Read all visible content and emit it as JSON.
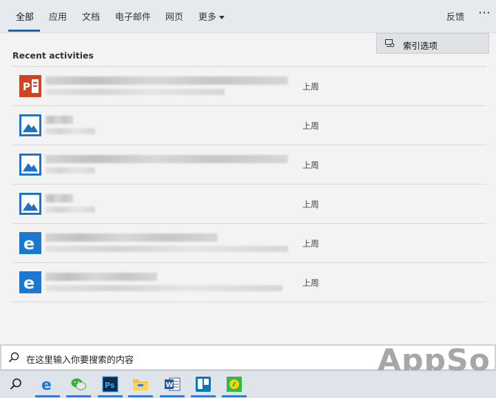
{
  "tabs": [
    {
      "label": "全部"
    },
    {
      "label": "应用"
    },
    {
      "label": "文档"
    },
    {
      "label": "电子邮件"
    },
    {
      "label": "网页"
    },
    {
      "label": "更多"
    }
  ],
  "header": {
    "feedback": "反馈",
    "ellipsis": "⋯"
  },
  "menu": {
    "index_options": "索引选项"
  },
  "recent": {
    "title": "Recent activities",
    "items": [
      {
        "icon": "powerpoint-icon",
        "time": "上周"
      },
      {
        "icon": "photos-icon",
        "time": "上周"
      },
      {
        "icon": "photos-icon",
        "time": "上周"
      },
      {
        "icon": "photos-icon",
        "time": "上周"
      },
      {
        "icon": "edge-icon",
        "time": "上周"
      },
      {
        "icon": "edge-icon",
        "time": "上周"
      }
    ]
  },
  "search": {
    "placeholder": "在这里输入你要搜索的内容"
  },
  "watermark": "AppSo",
  "taskbar": {
    "apps": [
      "edge-icon",
      "wechat-icon",
      "photoshop-icon",
      "file-explorer-icon",
      "word-icon",
      "trello-icon",
      "feeds-icon"
    ],
    "ps_label": "Ps",
    "word_label": "W"
  },
  "colors": {
    "accent": "#0a66c8",
    "powerpoint": "#d04423",
    "photos": "#1a73c9",
    "edge": "#1a78d2"
  }
}
